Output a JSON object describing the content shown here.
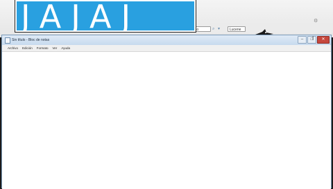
{
  "overlay": {
    "text": "JAJAJ",
    "color": "#29a0e0"
  },
  "background_toolbar": {
    "search_value": "ritmo",
    "search2_value": "Lucene"
  },
  "notepad": {
    "title": "Sin título - Bloc de notas",
    "window_buttons": [
      "–",
      "□",
      "✕"
    ],
    "menu": [
      "Archivo",
      "Edición",
      "Formato",
      "Ver",
      "Ayuda"
    ],
    "content": ""
  },
  "icons": [
    "gear-icon",
    "bird-icon",
    "notepad-icon",
    "text-cursor-icon"
  ]
}
